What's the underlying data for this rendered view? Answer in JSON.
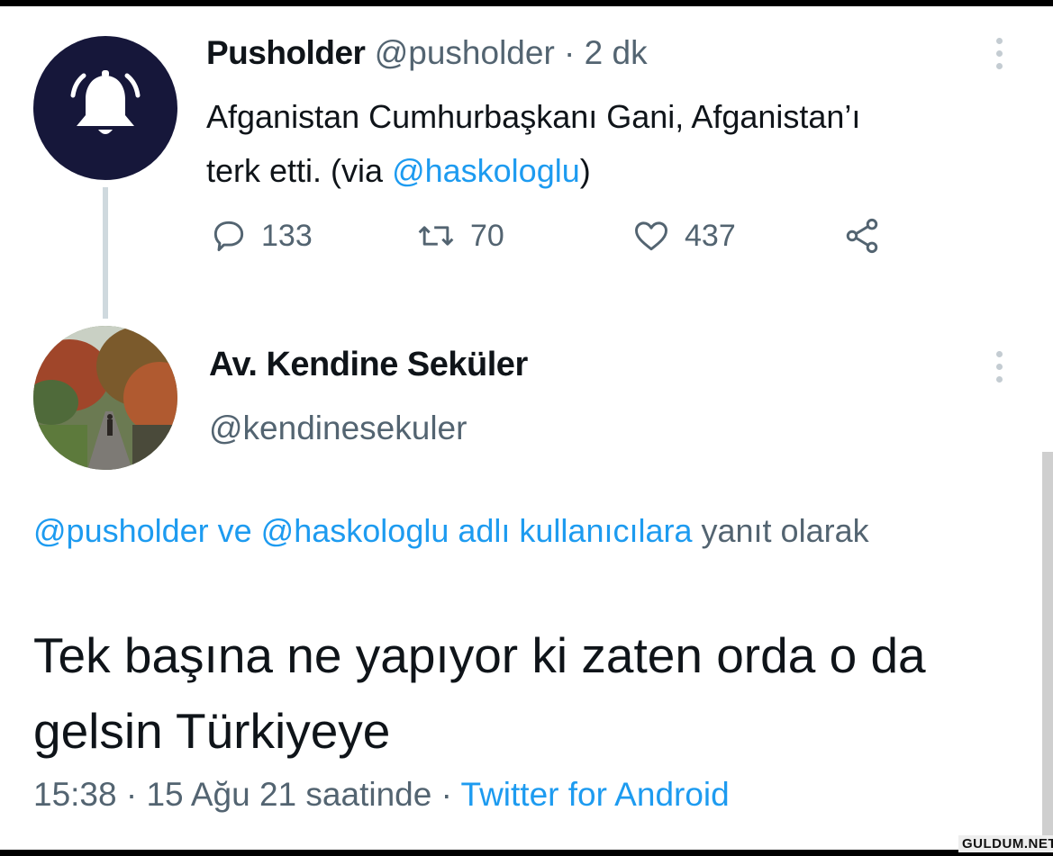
{
  "tweet": {
    "author_name": "Pusholder",
    "author_handle": "@pusholder",
    "separator": " · ",
    "time_ago": "2 dk",
    "text_line1": "Afganistan Cumhurbaşkanı Gani, Afganistan’ı",
    "text_line2_prefix": "terk etti. (via ",
    "text_mention": "@haskologlu",
    "text_suffix": ")",
    "replies": "133",
    "retweets": "70",
    "likes": "437",
    "avatar_icon": "bell-icon"
  },
  "reply": {
    "author_name": "Av. Kendine Seküler",
    "author_handle": "@kendinesekuler",
    "replying_mentions": "@pusholder ve @haskologlu adlı kullanıcılara",
    "replying_suffix": " yanıt olarak",
    "body": "Tek başına ne yapıyor ki zaten orda o da gelsin Türkiyeye",
    "timestamp": "15:38 · 15 Ağu 21 saatinde",
    "meta_separator": " · ",
    "client": "Twitter for Android"
  },
  "watermark": "GULDUM.NET",
  "colors": {
    "link": "#1d9bf0",
    "secondary": "#536471",
    "avatar_bg": "#16173a"
  }
}
